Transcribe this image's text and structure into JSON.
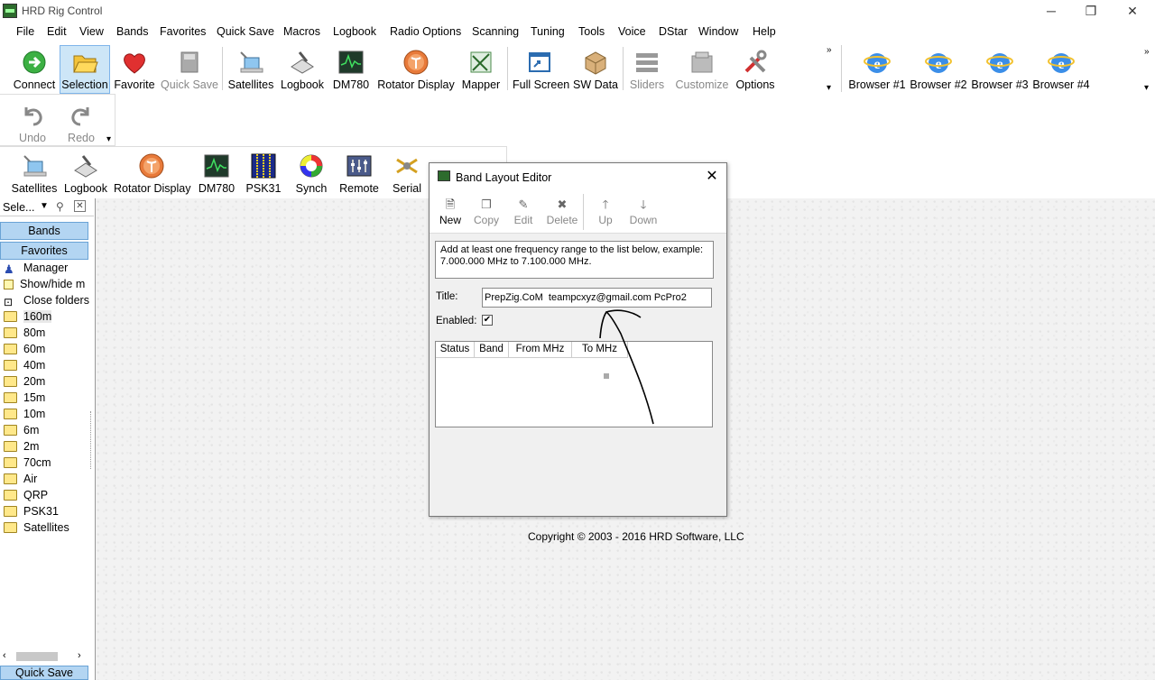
{
  "window": {
    "title": "HRD Rig Control"
  },
  "menu": [
    "File",
    "Edit",
    "View",
    "Bands",
    "Favorites",
    "Quick Save",
    "Macros",
    "Logbook",
    "Radio Options",
    "Scanning",
    "Tuning",
    "Tools",
    "Voice",
    "DStar",
    "Window",
    "Help"
  ],
  "toolbar1": [
    "Connect",
    "Selection",
    "Favorite",
    "Quick Save",
    "Satellites",
    "Logbook",
    "DM780",
    "Rotator Display",
    "Mapper",
    "Full Screen",
    "SW Data",
    "Sliders",
    "Customize",
    "Options"
  ],
  "toolbar_browsers": [
    "Browser #1",
    "Browser #2",
    "Browser #3",
    "Browser #4"
  ],
  "toolbar_undo": [
    "Undo",
    "Redo"
  ],
  "toolbar2": [
    "Satellites",
    "Logbook",
    "Rotator Display",
    "DM780",
    "PSK31",
    "Synch",
    "Remote",
    "Serial"
  ],
  "leftpanel": {
    "header": "Sele...",
    "tabs": {
      "bands": "Bands",
      "favorites": "Favorites",
      "quicksave": "Quick Save"
    },
    "items": [
      "Manager",
      "Show/hide m",
      "Close folders",
      "160m",
      "80m",
      "60m",
      "40m",
      "20m",
      "15m",
      "10m",
      "6m",
      "2m",
      "70cm",
      "Air",
      "QRP",
      "PSK31",
      "Satellites"
    ]
  },
  "main": {
    "copyright": "Copyright © 2003 - 2016 HRD Software, LLC"
  },
  "dialog": {
    "title": "Band Layout Editor",
    "toolbar": [
      "New",
      "Copy",
      "Edit",
      "Delete",
      "Up",
      "Down"
    ],
    "hint": "Add at least one frequency range to the list below, example: 7.000.000 MHz to 7.100.000 MHz.",
    "title_label": "Title:",
    "title_value": "PrepZig.CoM  teampcxyz@gmail.com PcPro2",
    "enabled_label": "Enabled:",
    "enabled_mark": "✔",
    "columns": [
      "Status",
      "Band",
      "From MHz",
      "To MHz"
    ]
  }
}
